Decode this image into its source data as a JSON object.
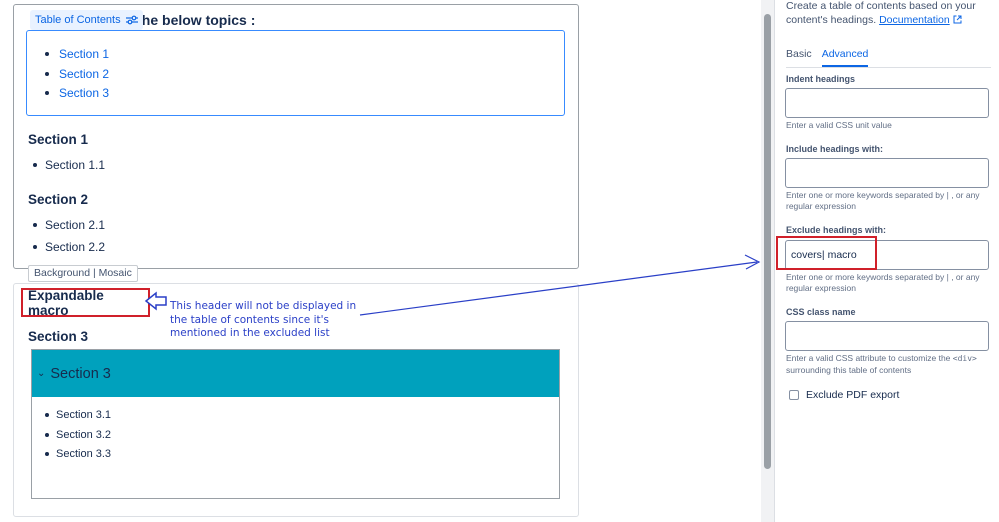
{
  "editor": {
    "intro_heading": "rs the below topics :",
    "toc_label": "Table of Contents",
    "toc_items": [
      "Section 1",
      "Section 2",
      "Section 3"
    ],
    "section1": {
      "title": "Section 1",
      "items": [
        "Section 1.1"
      ]
    },
    "section2": {
      "title": "Section 2",
      "items": [
        "Section 2.1",
        "Section 2.2"
      ]
    },
    "background_tag": "Background | Mosaic",
    "expandable_macro_title": "Expandable macro",
    "section3": {
      "title": "Section 3",
      "expand_title": "Section 3",
      "items": [
        "Section 3.1",
        "Section 3.2",
        "Section 3.3"
      ]
    },
    "annotation": "This header will not be displayed in the table of contents since it's mentioned in the excluded list"
  },
  "panel": {
    "description": "Create a table of contents based on your content's headings.",
    "documentation_link": "Documentation",
    "tabs": [
      "Basic",
      "Advanced"
    ],
    "active_tab": "Advanced",
    "indent": {
      "label": "Indent headings",
      "value": "",
      "help": "Enter a valid CSS unit value"
    },
    "include": {
      "label": "Include headings with:",
      "value": "",
      "help": "Enter one or more keywords separated by | , or any regular expression"
    },
    "exclude": {
      "label": "Exclude headings with:",
      "value": "covers| macro",
      "help": "Enter one or more keywords separated by | , or any regular expression"
    },
    "css_class": {
      "label": "CSS class name",
      "value": "",
      "help_before": "Enter a valid CSS attribute to customize the ",
      "help_code": "<div>",
      "help_after": " surrounding this table of contents"
    },
    "exclude_pdf": "Exclude PDF export"
  },
  "colors": {
    "highlight_red": "#d0202a",
    "annotation_blue": "#2a3fc7",
    "expand_bar": "#00a1bd",
    "link_blue": "#0c66e4"
  },
  "icons": [
    "settings-sliders-icon",
    "external-link-icon",
    "chevron-down-icon",
    "outline-left-arrow-icon"
  ]
}
